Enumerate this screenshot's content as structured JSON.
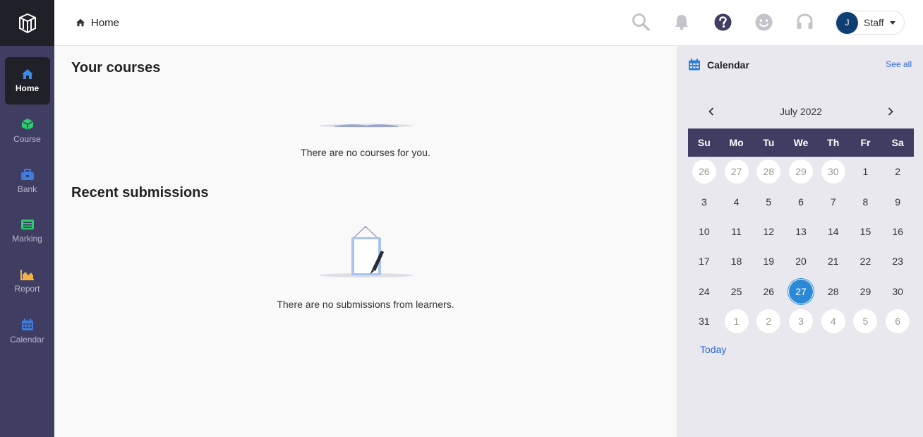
{
  "sidebar": {
    "items": [
      {
        "label": "Home",
        "icon": "home-icon",
        "color": "#3d8ae8"
      },
      {
        "label": "Course",
        "icon": "cube-icon",
        "color": "#2ecc71"
      },
      {
        "label": "Bank",
        "icon": "briefcase-icon",
        "color": "#3d7de0"
      },
      {
        "label": "Marking",
        "icon": "list-icon",
        "color": "#2ecc71"
      },
      {
        "label": "Report",
        "icon": "area-chart-icon",
        "color": "#f5b041"
      },
      {
        "label": "Calendar",
        "icon": "calendar-icon",
        "color": "#3d7de0"
      }
    ]
  },
  "header": {
    "breadcrumb": "Home",
    "user": {
      "initial": "J",
      "name": "Staff"
    }
  },
  "main": {
    "courses_title": "Your courses",
    "courses_empty": "There are no courses for you.",
    "submissions_title": "Recent submissions",
    "submissions_empty": "There are no submissions from learners."
  },
  "calendar": {
    "title": "Calendar",
    "see_all": "See all",
    "month": "July 2022",
    "weekdays": [
      "Su",
      "Mo",
      "Tu",
      "We",
      "Th",
      "Fr",
      "Sa"
    ],
    "weeks": [
      [
        "26",
        "27",
        "28",
        "29",
        "30",
        "1",
        "2"
      ],
      [
        "3",
        "4",
        "5",
        "6",
        "7",
        "8",
        "9"
      ],
      [
        "10",
        "11",
        "12",
        "13",
        "14",
        "15",
        "16"
      ],
      [
        "17",
        "18",
        "19",
        "20",
        "21",
        "22",
        "23"
      ],
      [
        "24",
        "25",
        "26",
        "27",
        "28",
        "29",
        "30"
      ],
      [
        "31",
        "1",
        "2",
        "3",
        "4",
        "5",
        "6"
      ]
    ],
    "today": "27",
    "today_link": "Today",
    "accent": "#2b8ad6"
  }
}
